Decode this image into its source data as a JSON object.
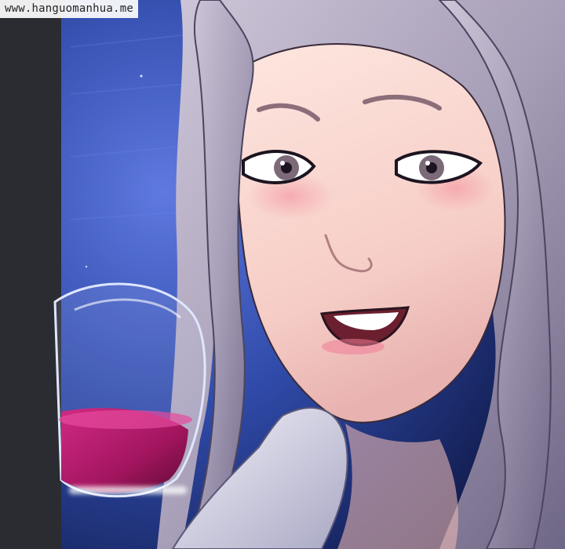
{
  "watermark": {
    "text": "www.hanguomanhua.me"
  },
  "colors": {
    "left_strip": "#2a2c31",
    "night_sky": "#243a8c",
    "hair": "#b9b2c6",
    "skin": "#f8d9d3",
    "wine": "#a3155f",
    "glass_rim": "#cfd8ff",
    "shirt": "#e7e6f2"
  },
  "artwork": {
    "kind": "comic-panel",
    "subject": "woman-holding-wine-glass-icon"
  }
}
